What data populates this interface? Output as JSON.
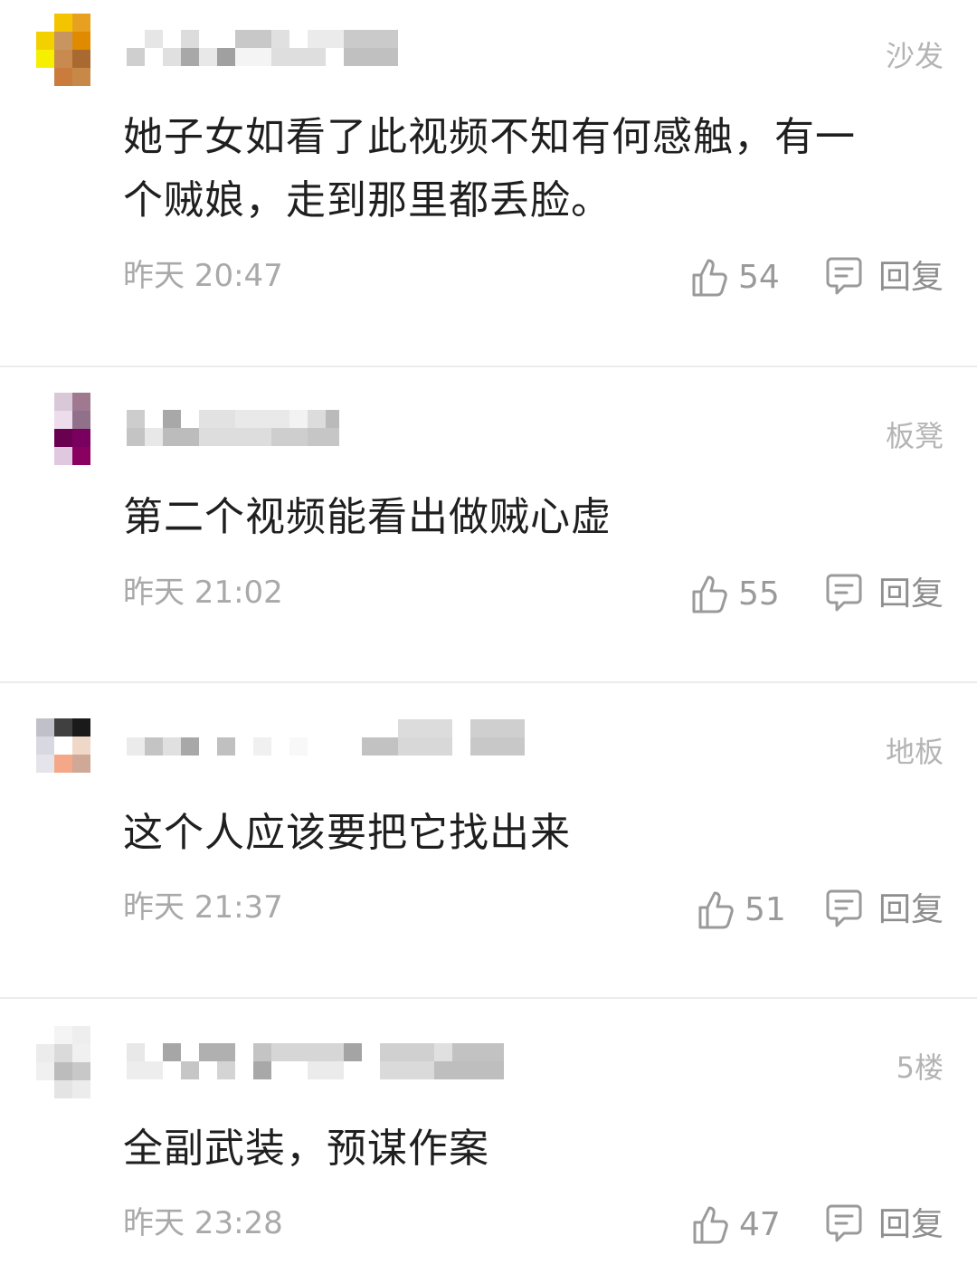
{
  "comments": [
    {
      "floor": "沙发",
      "text_line1": "她子女如看了此视频不知有何感触，有一",
      "text_line2": "个贼娘，走到那里都丢脸。",
      "time": "昨天 20:47",
      "likes": "54",
      "reply_label": "回复",
      "avatar_colors": [
        "#f4c400",
        "#e8a020",
        "#f3d000",
        "#c89560",
        "#e08a00",
        "#f6f000",
        "#b07030",
        "#c97c3c"
      ]
    },
    {
      "floor": "板凳",
      "text": "第二个视频能看出做贼心虚",
      "time": "昨天 21:02",
      "likes": "55",
      "reply_label": "回复",
      "avatar_colors": [
        "#d8c8d8",
        "#a07890",
        "#c0a8c0",
        "#90708a",
        "#6a0050",
        "#7a0060",
        "#e0c8e0",
        "#8a0060"
      ]
    },
    {
      "floor": "地板",
      "text": "这个人应该要把它找出来",
      "time": "昨天 21:37",
      "likes": "51",
      "reply_label": "回复",
      "avatar_colors": [
        "#c0c0c8",
        "#404040",
        "#1a1a1a",
        "#ffffff",
        "#f0d8c8",
        "#f5a888",
        "#d0a898",
        "#d8d8e0"
      ]
    },
    {
      "floor": "5楼",
      "text": "全副武装，预谋作案",
      "time": "昨天 23:28",
      "likes": "47",
      "reply_label": "回复",
      "avatar_colors": [
        "#f4f4f4",
        "#e8e8e8",
        "#dadada",
        "#c8c8c8",
        "#bcbcbc",
        "#ececec",
        "#f0f0f0",
        "#e4e4e4"
      ]
    }
  ],
  "icons": {
    "like": "thumbs-up-icon",
    "reply": "comment-bubble-icon"
  },
  "colors": {
    "text": "#1f1f1f",
    "meta": "#a9a9a9",
    "floor": "#b4b4b4",
    "divider": "#ececec"
  }
}
